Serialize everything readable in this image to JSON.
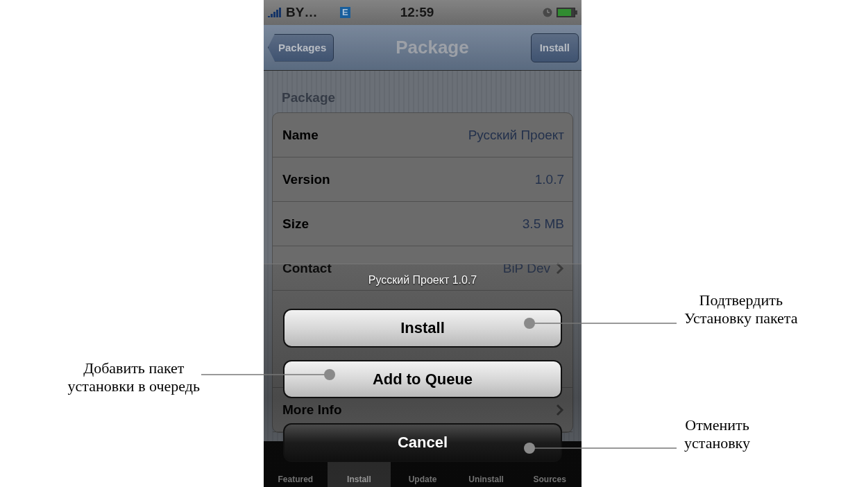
{
  "status_bar": {
    "carrier": "BY…",
    "network": "E",
    "time": "12:59"
  },
  "nav_bar": {
    "back": "Packages",
    "title": "Package",
    "action": "Install"
  },
  "section_title": "Package",
  "rows": [
    {
      "kind": "value",
      "label": "Name",
      "value": "Русский Проект"
    },
    {
      "kind": "value",
      "label": "Version",
      "value": "1.0.7"
    },
    {
      "kind": "value",
      "label": "Size",
      "value": "3.5 MB"
    },
    {
      "kind": "link",
      "label": "Contact",
      "value": "BiP Dev"
    },
    {
      "kind": "covered"
    },
    {
      "kind": "link",
      "label": "More Info"
    }
  ],
  "tab_bar": [
    {
      "label": "Featured",
      "selected": false
    },
    {
      "label": "Install",
      "selected": true
    },
    {
      "label": "Update",
      "selected": false
    },
    {
      "label": "Uninstall",
      "selected": false
    },
    {
      "label": "Sources",
      "selected": false
    }
  ],
  "action_sheet": {
    "title": "Русский Проект 1.0.7",
    "buttons": [
      {
        "label": "Install",
        "kind": "default"
      },
      {
        "label": "Add to Queue",
        "kind": "default"
      },
      {
        "label": "Cancel",
        "kind": "cancel"
      }
    ]
  },
  "annotations": [
    {
      "lines": [
        "Добавить пакет",
        "установки в очередь"
      ]
    },
    {
      "lines": [
        "Подтвердить",
        "Установку пакета"
      ]
    },
    {
      "lines": [
        "Отменить",
        "установку"
      ]
    }
  ]
}
